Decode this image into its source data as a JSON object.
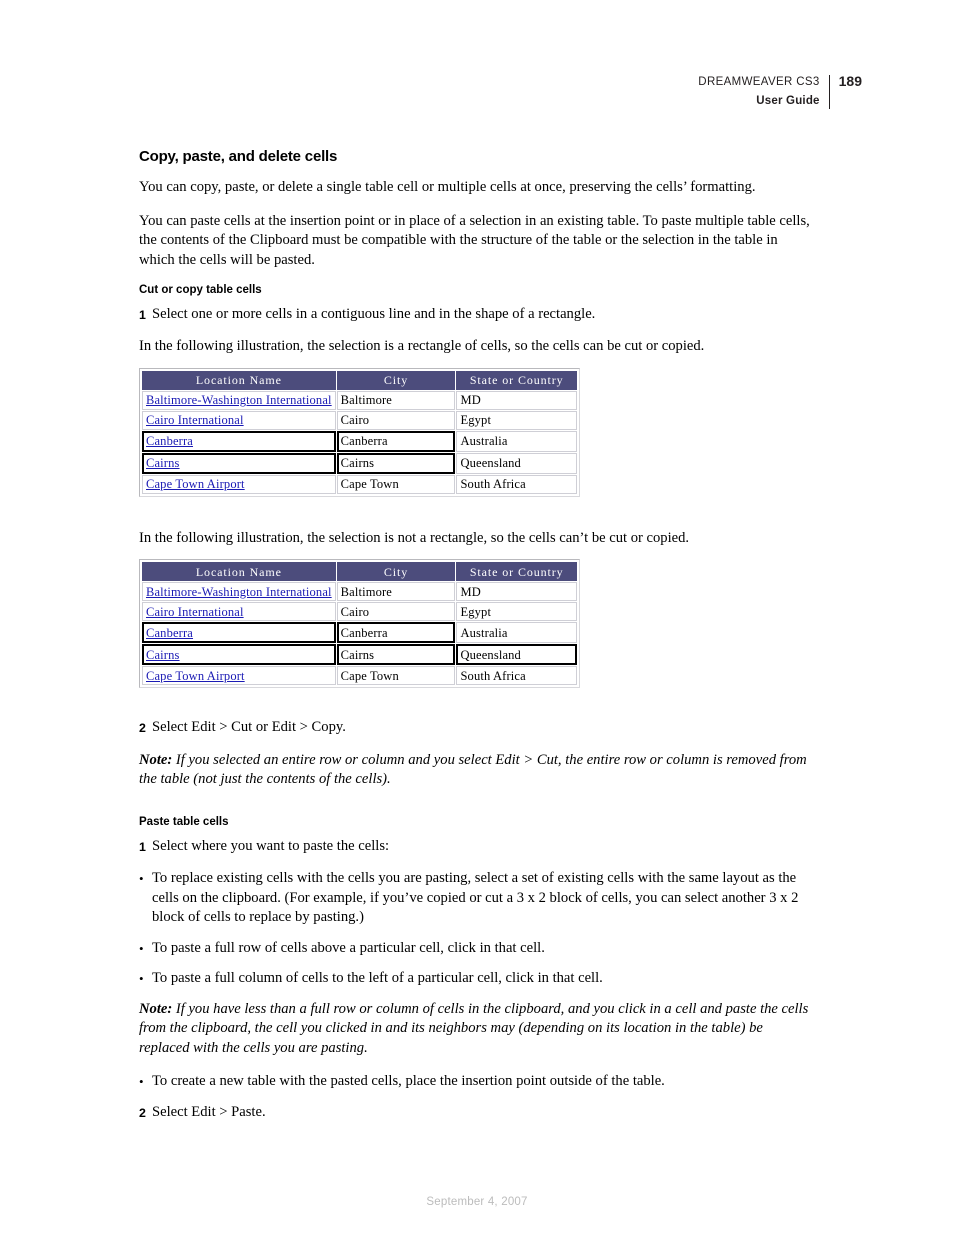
{
  "header": {
    "product": "DREAMWEAVER CS3",
    "guide": "User Guide",
    "page_number": "189"
  },
  "section": {
    "title": "Copy, paste, and delete cells",
    "intro_1": "You can copy, paste, or delete a single table cell or multiple cells at once, preserving the cells’ formatting.",
    "intro_2": "You can paste cells at the insertion point or in place of a selection in an existing table. To paste multiple table cells, the contents of the Clipboard must be compatible with the structure of the table or the selection in the table in which the cells will be pasted."
  },
  "cut_copy": {
    "title": "Cut or copy table cells",
    "step1_num": "1",
    "step1_text": "Select one or more cells in a contiguous line and in the shape of a rectangle.",
    "caption_rect": "In the following illustration, the selection is a rectangle of cells, so the cells can be cut or copied.",
    "caption_not_rect": "In the following illustration, the selection is not a rectangle, so the cells can’t be cut or copied.",
    "step2_num": "2",
    "step2_text": "Select Edit > Cut or Edit > Copy.",
    "note_label": "Note:",
    "note_text": " If you selected an entire row or column and you select Edit > Cut, the entire row or column is removed from the table (not just the contents of the cells)."
  },
  "paste": {
    "title": "Paste table cells",
    "step1_num": "1",
    "step1_text": "Select where you want to paste the cells:",
    "bullet_dot": "•",
    "bullets": [
      "To replace existing cells with the cells you are pasting, select a set of existing cells with the same layout as the cells on the clipboard. (For example, if you’ve copied or cut a 3 x 2 block of cells, you can select another 3 x 2 block of cells to replace by pasting.)",
      "To paste a full row of cells above a particular cell, click in that cell.",
      "To paste a full column of cells to the left of a particular cell, click in that cell.",
      "To create a new table with the pasted cells, place the insertion point outside of the table."
    ],
    "note_label": "Note:",
    "note_text": " If you have less than a full row or column of cells in the clipboard, and you click in a cell and paste the cells from the clipboard, the cell you clicked in and its neighbors may (depending on its location in the table) be replaced with the cells you are pasting.",
    "step2_num": "2",
    "step2_text": "Select Edit > Paste."
  },
  "table_figure_1": {
    "columns": [
      "Location Name",
      "City",
      "State or Country"
    ],
    "rows": [
      {
        "location": "Baltimore-Washington International",
        "city": "Baltimore",
        "state": "MD",
        "selected": [
          false,
          false,
          false
        ]
      },
      {
        "location": "Cairo International",
        "city": "Cairo",
        "state": "Egypt",
        "selected": [
          false,
          false,
          false
        ]
      },
      {
        "location": "Canberra",
        "city": "Canberra",
        "state": "Australia",
        "selected": [
          true,
          true,
          false
        ]
      },
      {
        "location": "Cairns",
        "city": "Cairns",
        "state": "Queensland",
        "selected": [
          true,
          true,
          false
        ]
      },
      {
        "location": "Cape Town Airport",
        "city": "Cape Town",
        "state": "South Africa",
        "selected": [
          false,
          false,
          false
        ]
      }
    ]
  },
  "table_figure_2": {
    "columns": [
      "Location Name",
      "City",
      "State or Country"
    ],
    "rows": [
      {
        "location": "Baltimore-Washington International",
        "city": "Baltimore",
        "state": "MD",
        "selected": [
          false,
          false,
          false
        ]
      },
      {
        "location": "Cairo International",
        "city": "Cairo",
        "state": "Egypt",
        "selected": [
          false,
          false,
          false
        ]
      },
      {
        "location": "Canberra",
        "city": "Canberra",
        "state": "Australia",
        "selected": [
          true,
          true,
          false
        ]
      },
      {
        "location": "Cairns",
        "city": "Cairns",
        "state": "Queensland",
        "selected": [
          true,
          true,
          true
        ]
      },
      {
        "location": "Cape Town Airport",
        "city": "Cape Town",
        "state": "South Africa",
        "selected": [
          false,
          false,
          false
        ]
      }
    ]
  },
  "footer": {
    "date": "September 4, 2007"
  },
  "colors": {
    "table_header_bg": "#4c4c7c",
    "link": "#1a1ab4",
    "selection_border": "#000000",
    "footer_text": "#bcbcbc"
  }
}
